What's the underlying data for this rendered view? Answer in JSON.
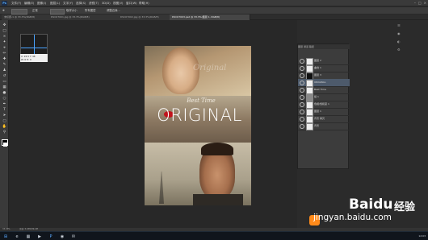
{
  "window": {
    "logo": "Ps"
  },
  "menu": {
    "items": [
      "文件(F)",
      "编辑(E)",
      "图像(I)",
      "图层(L)",
      "文字(Y)",
      "选择(S)",
      "滤镜(T)",
      "3D(D)",
      "视图(V)",
      "窗口(W)",
      "帮助(H)"
    ]
  },
  "options_bar": {
    "tool_icon": "move-tool-icon",
    "blend_label": "正常",
    "fill_label": "取样大小",
    "mode_label": "所有图层",
    "button_label": "调整边缘..."
  },
  "tabs": [
    {
      "label": "未标题-1 @ 33.3%(RGB/8)",
      "active": false
    },
    {
      "label": "DSC07001.jpg @ 33.3%(RGB/8)",
      "active": false
    },
    {
      "label": "DSC07002.jpg @ 33.3%(RGB/8)",
      "active": false
    },
    {
      "label": "DSC07003.psd @ 33.3%(图层 1, RGB/8)",
      "active": true
    }
  ],
  "canvas": {
    "script_title": "Best Time",
    "big_title": "ORIGINAL",
    "watermark": "Original"
  },
  "navigator": {
    "info_line1": "X:  24.5  Y:  46",
    "info_line2": "W:  0  H:  0"
  },
  "layers_panel": {
    "tabs": "图层  通道  路径",
    "rows": [
      {
        "label": "图层 2"
      },
      {
        "label": "曲线 1"
      },
      {
        "label": "图层 3"
      },
      {
        "label": "ORIGINAL",
        "selected": true
      },
      {
        "label": "Best Time"
      },
      {
        "label": "组 1"
      },
      {
        "label": "色相/饱和度 1"
      },
      {
        "label": "图层 1"
      },
      {
        "label": "背景 拷贝"
      },
      {
        "label": "背景"
      }
    ]
  },
  "status": {
    "zoom": "33.33%",
    "doc": "文档: 5.93M/39.2M"
  },
  "watermark_site": {
    "brand": "Baidu",
    "brand_cn": "经验",
    "url": "jingyan.baidu.com"
  },
  "taskbar": {
    "time": "12:03"
  }
}
